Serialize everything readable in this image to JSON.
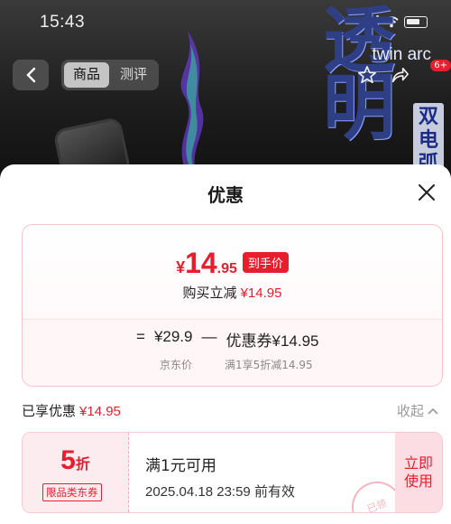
{
  "status_bar": {
    "time": "15:43"
  },
  "header": {
    "tabs": [
      {
        "label": "商品",
        "active": true
      },
      {
        "label": "测评",
        "active": false
      }
    ],
    "cart_badge": "6+"
  },
  "product_banner": {
    "big_text": "透明",
    "brand_text": "twin arc",
    "side_text": "双电弧"
  },
  "sheet": {
    "title": "优惠",
    "hand_price": {
      "yen": "¥",
      "integer": "14",
      "decimal": ".95",
      "tag": "到手价"
    },
    "reduce": {
      "label": "购买立减",
      "amount": "¥14.95"
    },
    "formula": {
      "equals": "=",
      "jd_price": "¥29.9",
      "minus": "—",
      "coupon_label": "优惠券¥14.95",
      "jd_price_caption": "京东价",
      "coupon_caption": "满1享5折减14.95"
    },
    "enjoyed": {
      "label": "已享优惠",
      "amount": "¥14.95",
      "collapse_label": "收起"
    },
    "coupon": {
      "discount_num": "5",
      "discount_unit": "折",
      "tag": "限品类东券",
      "condition": "满1元可用",
      "expiry": "2025.04.18 23:59 前有效",
      "use_button": "立即使用",
      "stamp": "已领"
    }
  },
  "colors": {
    "accent_red": "#e81d2d",
    "card_border": "#f5c4cc",
    "coupon_bg": "#fdecef"
  }
}
